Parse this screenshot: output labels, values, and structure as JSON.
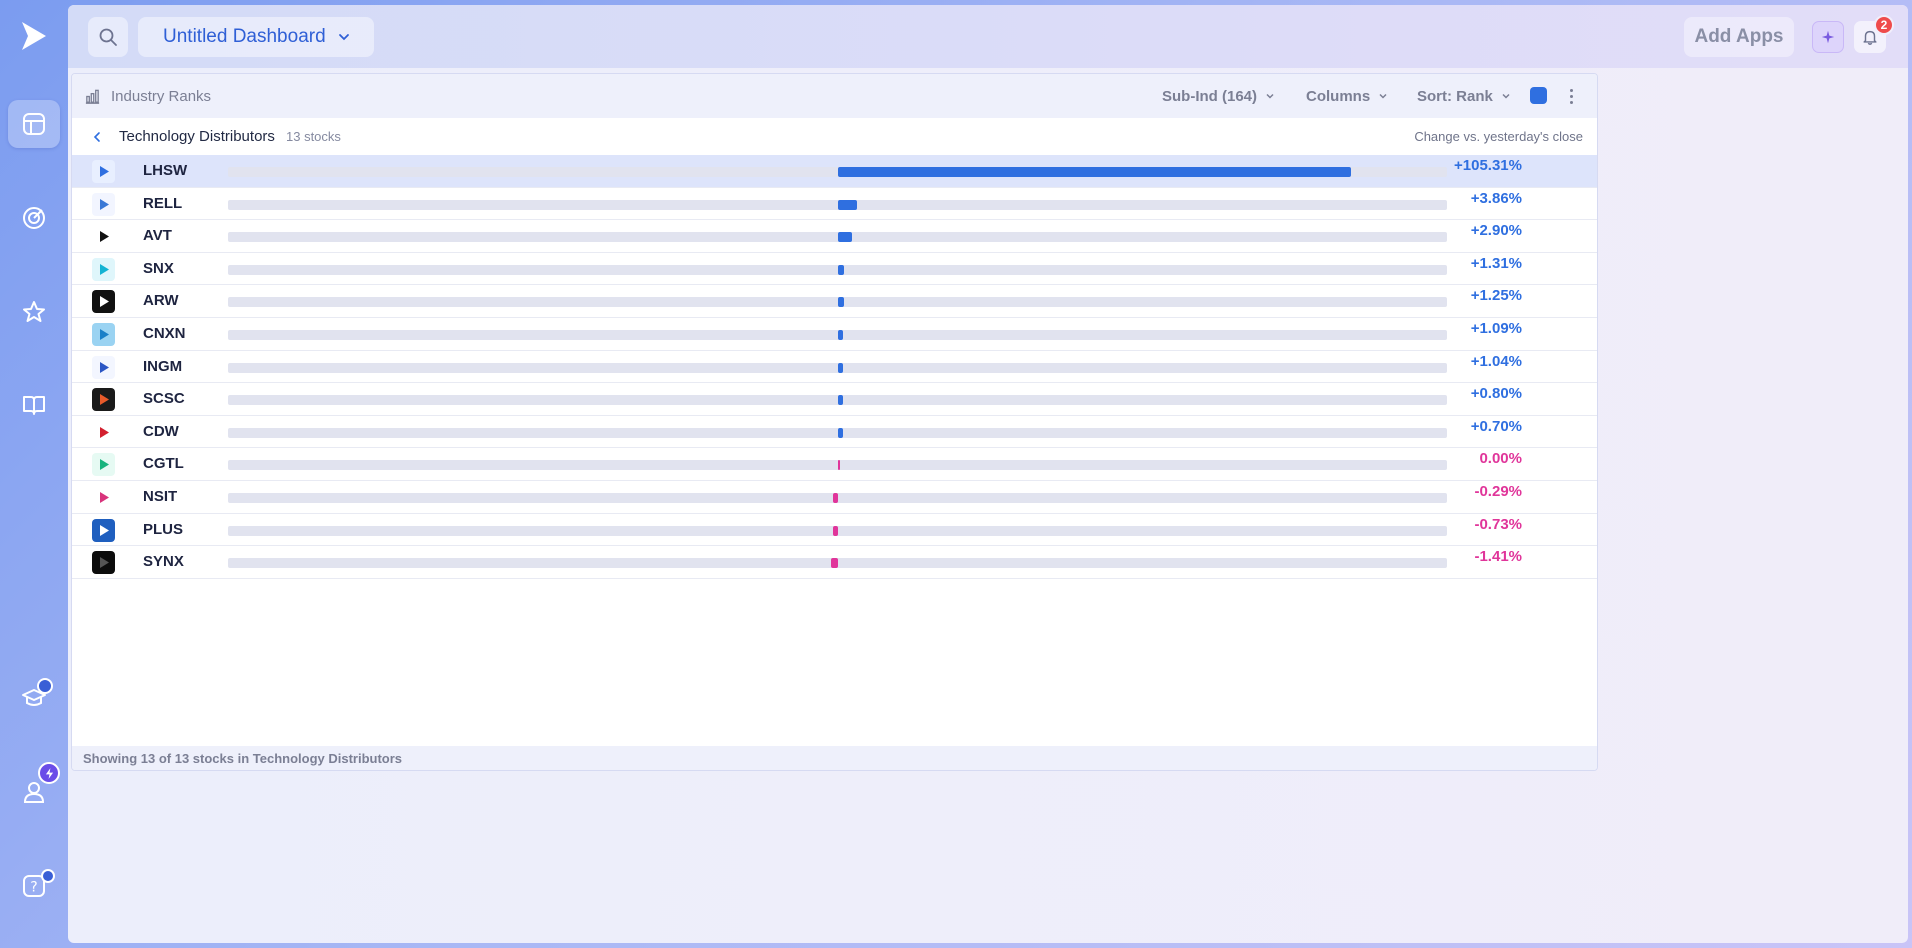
{
  "topbar": {
    "dashboard_title": "Untitled Dashboard",
    "add_apps_label": "Add Apps",
    "notification_count": "2"
  },
  "panel": {
    "title": "Industry Ranks",
    "sub_ind_label": "Sub-Ind (164)",
    "columns_label": "Columns",
    "sort_label": "Sort: Rank",
    "color_swatch": "#2f6fe0",
    "subheader": {
      "group_name": "Technology Distributors",
      "count_label": "13 stocks",
      "right_label": "Change vs. yesterday's close"
    },
    "footer": "Showing 13 of 13 stocks in Technology Distributors"
  },
  "colors": {
    "positive": "#2f6fe0",
    "negative": "#e0359a",
    "accent": "#2f5fd6"
  },
  "stocks": [
    {
      "symbol": "LHSW",
      "change": "+105.31%",
      "value": 105.31,
      "logo": "play-logo-icon",
      "logo_bg": "#e8efff",
      "logo_fg": "#2f6fe0"
    },
    {
      "symbol": "RELL",
      "change": "+3.86%",
      "value": 3.86,
      "logo": "rell-logo-icon",
      "logo_bg": "#f2f5ff",
      "logo_fg": "#3a78d6"
    },
    {
      "symbol": "AVT",
      "change": "+2.90%",
      "value": 2.9,
      "logo": "avnet-logo-icon",
      "logo_bg": "#ffffff",
      "logo_fg": "#111111"
    },
    {
      "symbol": "SNX",
      "change": "+1.31%",
      "value": 1.31,
      "logo": "snx-logo-icon",
      "logo_bg": "#dff6fb",
      "logo_fg": "#14b3d3"
    },
    {
      "symbol": "ARW",
      "change": "+1.25%",
      "value": 1.25,
      "logo": "arrow-logo-icon",
      "logo_bg": "#111111",
      "logo_fg": "#ffffff"
    },
    {
      "symbol": "CNXN",
      "change": "+1.09%",
      "value": 1.09,
      "logo": "cnxn-logo-icon",
      "logo_bg": "#9ad3f2",
      "logo_fg": "#1a80c8"
    },
    {
      "symbol": "INGM",
      "change": "+1.04%",
      "value": 1.04,
      "logo": "ingm-logo-icon",
      "logo_bg": "#f3f6ff",
      "logo_fg": "#2b56c4"
    },
    {
      "symbol": "SCSC",
      "change": "+0.80%",
      "value": 0.8,
      "logo": "scsc-logo-icon",
      "logo_bg": "#1a1a1a",
      "logo_fg": "#e85a2a"
    },
    {
      "symbol": "CDW",
      "change": "+0.70%",
      "value": 0.7,
      "logo": "cdw-logo-icon",
      "logo_bg": "#ffffff",
      "logo_fg": "#d3202f"
    },
    {
      "symbol": "CGTL",
      "change": "0.00%",
      "value": 0.0,
      "logo": "cgtl-logo-icon",
      "logo_bg": "#e6faf3",
      "logo_fg": "#17b47d"
    },
    {
      "symbol": "NSIT",
      "change": "-0.29%",
      "value": -0.29,
      "logo": "nsit-logo-icon",
      "logo_bg": "#ffffff",
      "logo_fg": "#d8347c"
    },
    {
      "symbol": "PLUS",
      "change": "-0.73%",
      "value": -0.73,
      "logo": "eplus-logo-icon",
      "logo_bg": "#1f5fbf",
      "logo_fg": "#ffffff"
    },
    {
      "symbol": "SYNX",
      "change": "-1.41%",
      "value": -1.41,
      "logo": "synx-logo-icon",
      "logo_bg": "#0c0c0c",
      "logo_fg": "#555555"
    }
  ],
  "bar_scale": {
    "max_abs_value": 125
  }
}
